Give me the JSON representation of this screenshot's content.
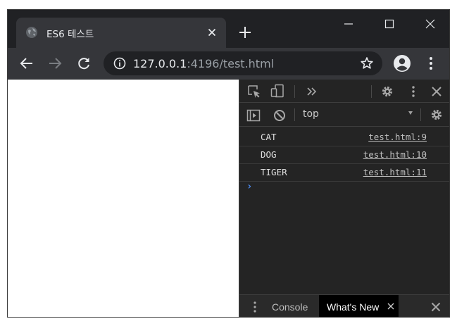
{
  "tab": {
    "title": "ES6 테스트",
    "favicon": "globe-icon"
  },
  "address_bar": {
    "host": "127.0.0.1",
    "rest": ":4196/test.html"
  },
  "devtools": {
    "context": "top",
    "console_logs": [
      {
        "message": "CAT",
        "source": "test.html:9"
      },
      {
        "message": "DOG",
        "source": "test.html:10"
      },
      {
        "message": "TIGER",
        "source": "test.html:11"
      }
    ],
    "prompt_symbol": "›",
    "drawer_tabs": {
      "console": "Console",
      "whats_new": "What's New"
    }
  },
  "colors": {
    "titlebar": "#202124",
    "toolbar": "#35363a",
    "devtools_bg": "#242424",
    "prompt_accent": "#4d8ef5"
  }
}
